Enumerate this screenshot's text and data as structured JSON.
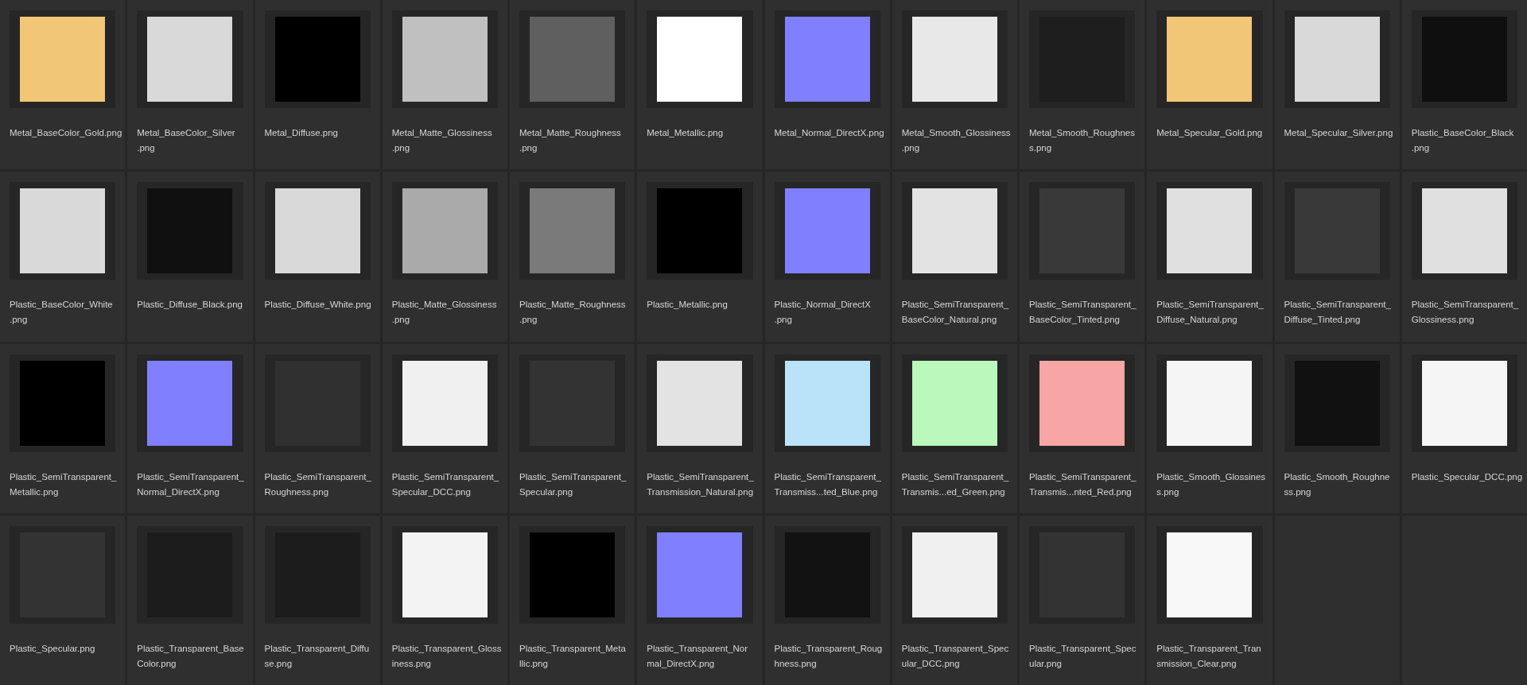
{
  "files": [
    {
      "lines": [
        "Metal_BaseColor_Gold.png"
      ],
      "color": "#f2c677"
    },
    {
      "lines": [
        "Metal_BaseColor_Silver",
        ".png"
      ],
      "color": "#d9d9d9"
    },
    {
      "lines": [
        "Metal_Diffuse.png"
      ],
      "color": "#000000"
    },
    {
      "lines": [
        "Metal_Matte_Glossiness",
        ".png"
      ],
      "color": "#c0c0c0"
    },
    {
      "lines": [
        "Metal_Matte_Roughness",
        ".png"
      ],
      "color": "#5f5f5f"
    },
    {
      "lines": [
        "Metal_Metallic.png"
      ],
      "color": "#ffffff"
    },
    {
      "lines": [
        "Metal_Normal_DirectX.png"
      ],
      "color": "#8080ff"
    },
    {
      "lines": [
        "Metal_Smooth_Glossiness",
        ".png"
      ],
      "color": "#e8e8e8"
    },
    {
      "lines": [
        "Metal_Smooth_Roughnes",
        "s.png"
      ],
      "color": "#1e1e1e"
    },
    {
      "lines": [
        "Metal_Specular_Gold.png"
      ],
      "color": "#f2c677"
    },
    {
      "lines": [
        "Metal_Specular_Silver.png"
      ],
      "color": "#d9d9d9"
    },
    {
      "lines": [
        "Plastic_BaseColor_Black",
        ".png"
      ],
      "color": "#0f0f0f"
    },
    {
      "lines": [
        "Plastic_BaseColor_White",
        ".png"
      ],
      "color": "#d9d9d9"
    },
    {
      "lines": [
        "Plastic_Diffuse_Black.png"
      ],
      "color": "#101010"
    },
    {
      "lines": [
        "Plastic_Diffuse_White.png"
      ],
      "color": "#d9d9d9"
    },
    {
      "lines": [
        "Plastic_Matte_Glossiness",
        ".png"
      ],
      "color": "#aaaaaa"
    },
    {
      "lines": [
        "Plastic_Matte_Roughness",
        ".png"
      ],
      "color": "#7a7a7a"
    },
    {
      "lines": [
        "Plastic_Metallic.png"
      ],
      "color": "#000000"
    },
    {
      "lines": [
        "Plastic_Normal_DirectX",
        ".png"
      ],
      "color": "#8080ff"
    },
    {
      "lines": [
        "Plastic_SemiTransparent_",
        "BaseColor_Natural.png"
      ],
      "color": "#e3e3e3"
    },
    {
      "lines": [
        "Plastic_SemiTransparent_",
        "BaseColor_Tinted.png"
      ],
      "color": "#393939"
    },
    {
      "lines": [
        "Plastic_SemiTransparent_",
        "Diffuse_Natural.png"
      ],
      "color": "#e0e0e0"
    },
    {
      "lines": [
        "Plastic_SemiTransparent_",
        "Diffuse_Tinted.png"
      ],
      "color": "#393939"
    },
    {
      "lines": [
        "Plastic_SemiTransparent_",
        "Glossiness.png"
      ],
      "color": "#e0e0e0"
    },
    {
      "lines": [
        "Plastic_SemiTransparent_",
        "Metallic.png"
      ],
      "color": "#000000"
    },
    {
      "lines": [
        "Plastic_SemiTransparent_",
        "Normal_DirectX.png"
      ],
      "color": "#8080ff"
    },
    {
      "lines": [
        "Plastic_SemiTransparent_",
        "Roughness.png"
      ],
      "color": "#303030"
    },
    {
      "lines": [
        "Plastic_SemiTransparent_",
        "Specular_DCC.png"
      ],
      "color": "#f0f0f0"
    },
    {
      "lines": [
        "Plastic_SemiTransparent_",
        "Specular.png"
      ],
      "color": "#333333"
    },
    {
      "lines": [
        "Plastic_SemiTransparent_",
        "Transmission_Natural.png"
      ],
      "color": "#e3e3e3"
    },
    {
      "lines": [
        "Plastic_SemiTransparent_",
        "Transmiss...ted_Blue.png"
      ],
      "color": "#bae2f8"
    },
    {
      "lines": [
        "Plastic_SemiTransparent_",
        "Transmis...ed_Green.png"
      ],
      "color": "#bbf8bb"
    },
    {
      "lines": [
        "Plastic_SemiTransparent_",
        "Transmis...nted_Red.png"
      ],
      "color": "#f8a5a5"
    },
    {
      "lines": [
        "Plastic_Smooth_Glossines",
        "s.png"
      ],
      "color": "#f5f5f5"
    },
    {
      "lines": [
        "Plastic_Smooth_Roughne",
        "ss.png"
      ],
      "color": "#111111"
    },
    {
      "lines": [
        "Plastic_Specular_DCC.png"
      ],
      "color": "#f5f5f5"
    },
    {
      "lines": [
        "Plastic_Specular.png"
      ],
      "color": "#333333"
    },
    {
      "lines": [
        "Plastic_Transparent_Base",
        "Color.png"
      ],
      "color": "#1c1c1c"
    },
    {
      "lines": [
        "Plastic_Transparent_Diffu",
        "se.png"
      ],
      "color": "#1c1c1c"
    },
    {
      "lines": [
        "Plastic_Transparent_Gloss",
        "iness.png"
      ],
      "color": "#f3f3f3"
    },
    {
      "lines": [
        "Plastic_Transparent_Meta",
        "llic.png"
      ],
      "color": "#000000"
    },
    {
      "lines": [
        "Plastic_Transparent_Nor",
        "mal_DirectX.png"
      ],
      "color": "#8080ff"
    },
    {
      "lines": [
        "Plastic_Transparent_Roug",
        "hness.png"
      ],
      "color": "#121212"
    },
    {
      "lines": [
        "Plastic_Transparent_Spec",
        "ular_DCC.png"
      ],
      "color": "#f0f0f0"
    },
    {
      "lines": [
        "Plastic_Transparent_Spec",
        "ular.png"
      ],
      "color": "#333333"
    },
    {
      "lines": [
        "Plastic_Transparent_Tran",
        "smission_Clear.png"
      ],
      "color": "#f8f8f8"
    }
  ]
}
